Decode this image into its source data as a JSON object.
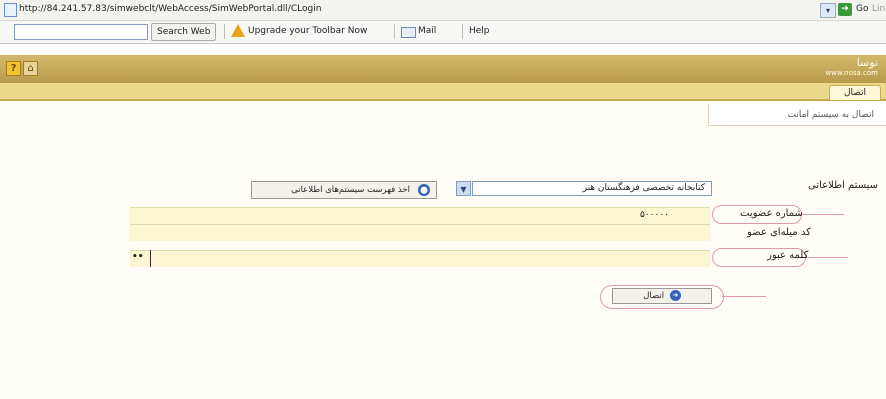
{
  "browser": {
    "url": "http://84.241.57.83/simwebclt/WebAccess/SimWebPortal.dll/CLogin",
    "go_label": "Go",
    "links_label": "Links"
  },
  "toolbar": {
    "search_button": "Search Web",
    "upgrade_label": "Upgrade your Toolbar Now",
    "mail_label": "Mail",
    "help_label": "Help"
  },
  "app": {
    "logo_text": "نوسا",
    "logo_url": "www.nosa.com",
    "tab_label": "اتصال",
    "subtitle": "اتصال به سیستم امانت"
  },
  "form": {
    "system_label": "سیستم اطلاعاتی",
    "system_value": "کتابخانه تخصصی فرهنگستان هنر",
    "list_button": "اخذ فهرست سیستم‌های اطلاعاتی",
    "member_label": "شماره عضویت",
    "member_value": "۵۰۰۰۰۰",
    "code_label": "کد میله‌ای عضو",
    "password_label": "کلمه عبور",
    "password_value": "••",
    "login_button": "اتصال"
  },
  "colors": {
    "header_gold": "#c8ab5d",
    "row_yellow": "#fcf6d2",
    "highlight_pink": "#e19aa6"
  }
}
